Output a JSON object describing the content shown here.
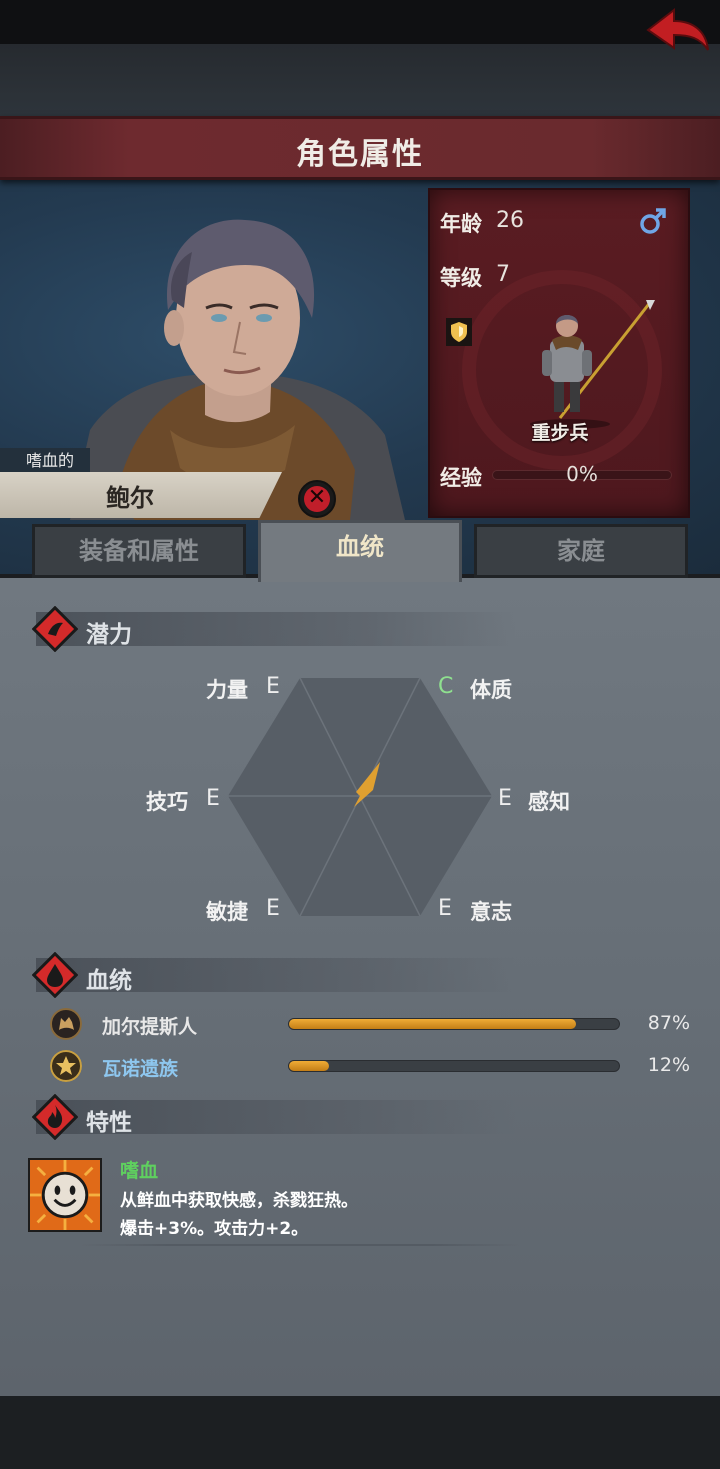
{
  "header": {
    "title": "角色属性",
    "back_icon": "back-arrow-icon"
  },
  "character": {
    "trait_tag": "嗜血的",
    "name": "鲍尔",
    "stats": {
      "age_label": "年龄",
      "age": "26",
      "level_label": "等级",
      "level": "7",
      "gender_icon": "male-icon",
      "class_name": "重步兵",
      "exp_label": "经验",
      "exp_percent": "0%",
      "exp_fraction": 0.0
    }
  },
  "tabs": [
    {
      "label": "装备和属性",
      "active": false
    },
    {
      "label": "血统",
      "active": true
    },
    {
      "label": "家庭",
      "active": false
    }
  ],
  "potential": {
    "title": "潜力",
    "attributes": {
      "strength": {
        "label": "力量",
        "grade": "E"
      },
      "constitution": {
        "label": "体质",
        "grade": "C"
      },
      "skill": {
        "label": "技巧",
        "grade": "E"
      },
      "perception": {
        "label": "感知",
        "grade": "E"
      },
      "agility": {
        "label": "敏捷",
        "grade": "E"
      },
      "will": {
        "label": "意志",
        "grade": "E"
      }
    }
  },
  "bloodline": {
    "title": "血统",
    "items": [
      {
        "name": "加尔提斯人",
        "percent": "87%",
        "fraction": 0.87,
        "icon": "wolf-emblem-icon"
      },
      {
        "name": "瓦诺遗族",
        "percent": "12%",
        "fraction": 0.12,
        "icon": "star-emblem-icon"
      }
    ]
  },
  "traits": {
    "title": "特性",
    "items": [
      {
        "name": "嗜血",
        "desc_line1": "从鲜血中获取快感，杀戮狂热。",
        "desc_line2": "爆击+3%。攻击力+2。",
        "icon": "grin-face-icon"
      }
    ]
  },
  "colors": {
    "accent_gold": "#e0a030",
    "banner_red": "#6e2a2f",
    "trait_green": "#5fd05f",
    "bloodline_blue": "#8ec7ef"
  }
}
